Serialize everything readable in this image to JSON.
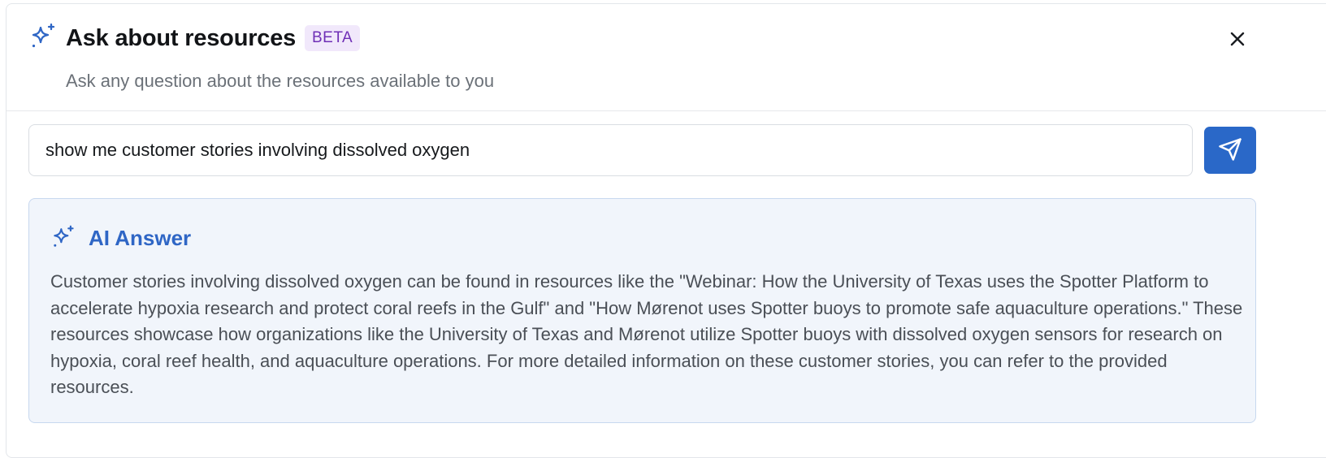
{
  "header": {
    "icon": "sparkles-icon",
    "title": "Ask about resources",
    "badge": "BETA",
    "subtitle": "Ask any question about the resources available to you",
    "close_icon": "close-icon"
  },
  "query": {
    "value": "show me customer stories involving dissolved oxygen",
    "send_icon": "paper-plane-icon"
  },
  "answer": {
    "icon": "sparkles-icon",
    "title": "AI Answer",
    "text": "Customer stories involving dissolved oxygen can be found in resources like the \"Webinar: How the University of Texas uses the Spotter Platform to accelerate hypoxia research and protect coral reefs in the Gulf\" and \"How Mørenot uses Spotter buoys to promote safe aquaculture operations.\" These resources showcase how organizations like the University of Texas and Mørenot utilize Spotter buoys with dissolved oxygen sensors for research on hypoxia, coral reef health, and aquaculture operations. For more detailed information on these customer stories, you can refer to the provided resources."
  },
  "colors": {
    "accent": "#2f66c5",
    "send_button": "#2a68c8",
    "badge_bg": "#f1e8fb",
    "badge_text": "#6f2fb6",
    "answer_bg": "#f1f5fb",
    "answer_border": "#c7d8ef"
  }
}
